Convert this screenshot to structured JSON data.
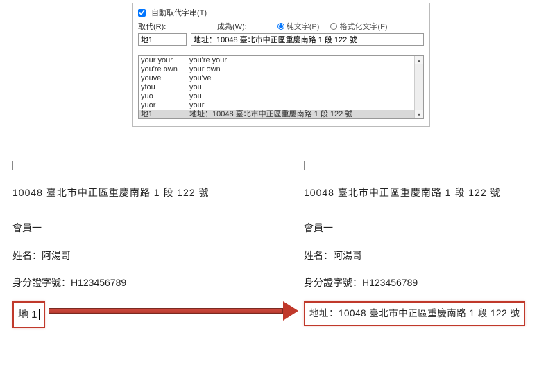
{
  "panel": {
    "checkbox_label": "自動取代字串(T)",
    "replace_label": "取代(R):",
    "with_label": "成為(W):",
    "radio_plain": "純文字(P)",
    "radio_format": "格式化文字(F)",
    "input_replace": "地1",
    "input_with": "地址：10048 臺北市中正區重慶南路 1 段 122 號",
    "rows": [
      {
        "l": "your your",
        "r": "you're your"
      },
      {
        "l": "you're own",
        "r": "your own"
      },
      {
        "l": "youve",
        "r": "you've"
      },
      {
        "l": "ytou",
        "r": "you"
      },
      {
        "l": "yuo",
        "r": "you"
      },
      {
        "l": "yuor",
        "r": "your"
      },
      {
        "l": "地1",
        "r": "地址：10048 臺北市中正區重慶南路 1 段 122 號"
      }
    ]
  },
  "doc": {
    "address_header": "10048  臺北市中正區重慶南路  1  段  122  號",
    "member": "會員一",
    "name_line": "姓名：阿湯哥",
    "id_line": "身分證字號：H123456789",
    "typed_short": "地 1",
    "typed_full": "地址：10048  臺北市中正區重慶南路  1  段  122  號"
  }
}
